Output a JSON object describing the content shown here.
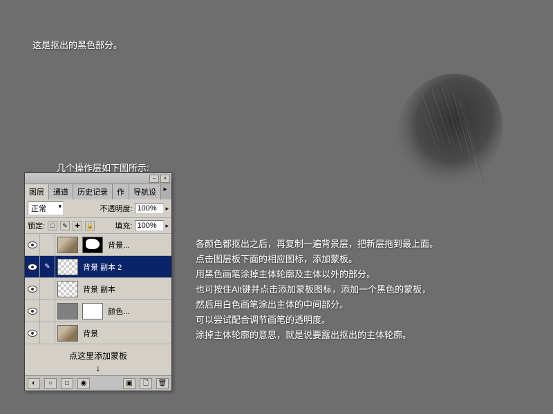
{
  "top_text": "这是抠出的黑色部分。",
  "panel_label": "几个操作层如下图所示:",
  "instructions": [
    "各颜色都抠出之后，再复制一遍背景层，把新层拖到最上面。",
    "点击图层板下面的相应图标，添加蒙板。",
    "用黑色画笔涂掉主体轮廓及主体以外的部分。",
    "也可按住Alt键并点击添加蒙板图标，添加一个黑色的蒙板，",
    "然后用白色画笔涂出主体的中间部分。",
    "可以尝试配合调节画笔的透明度。",
    "涂掉主体轮廓的意思，就是说要露出抠出的主体轮廓。"
  ],
  "panel": {
    "minimize": "–",
    "close": "×",
    "tabs": [
      "图层",
      "通道",
      "历史记录",
      "作",
      "导航设"
    ],
    "options": "▸",
    "blend_mode": "正常",
    "opacity_label": "不透明度:",
    "opacity_value": "100%",
    "lock_label": "锁定:",
    "lock_icons": [
      "□",
      "✎",
      "✚",
      "🔒"
    ],
    "fill_label": "填充:",
    "fill_value": "100%",
    "layers": [
      {
        "name": "背景...",
        "thumb": "dog",
        "mask": "shape"
      },
      {
        "name": "背景 副本 2",
        "thumb": "checker",
        "selected": true,
        "brush": true
      },
      {
        "name": "背景 副本",
        "thumb": "checker"
      },
      {
        "name": "颜色...",
        "thumb": "gray",
        "mask": "white"
      },
      {
        "name": "背景",
        "thumb": "dog"
      }
    ],
    "mask_hint": "点这里添加蒙板",
    "arrow": "↓",
    "footer_icons": [
      "◐",
      "○",
      "□",
      "◉",
      "▣",
      "🗋",
      "🗑"
    ]
  }
}
